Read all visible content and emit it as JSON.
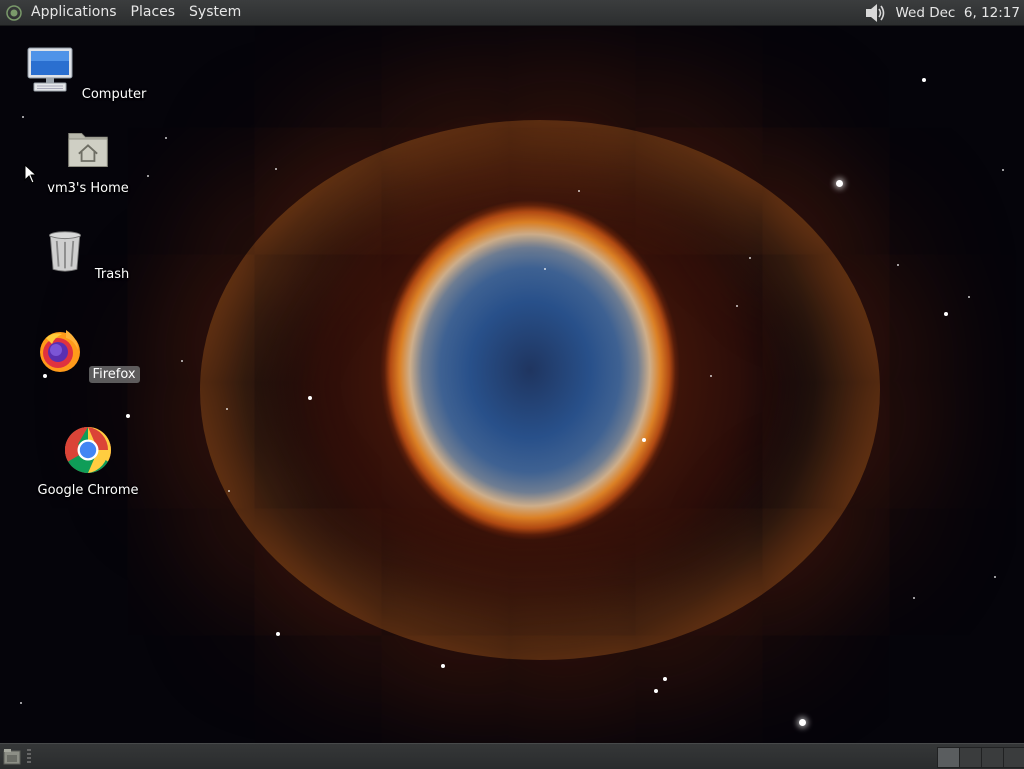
{
  "top_panel": {
    "menus": [
      "Applications",
      "Places",
      "System"
    ],
    "clock": "Wed Dec  6, 12:17",
    "icons": {
      "logo": "gnome-foot-icon",
      "volume": "speaker-volume-icon"
    }
  },
  "desktop": {
    "wallpaper": "helix-nebula",
    "icons": [
      {
        "label": "Computer",
        "icon": "computer-monitor-icon"
      },
      {
        "label": "vm3's Home",
        "icon": "home-folder-icon"
      },
      {
        "label": "Trash",
        "icon": "trash-can-icon"
      },
      {
        "label": "Firefox",
        "icon": "firefox-icon",
        "selected": true
      },
      {
        "label": "Google Chrome",
        "icon": "chrome-icon"
      }
    ]
  },
  "bottom_panel": {
    "show_desktop_icon": "show-desktop-icon",
    "workspaces": 4,
    "active_workspace": 1
  }
}
